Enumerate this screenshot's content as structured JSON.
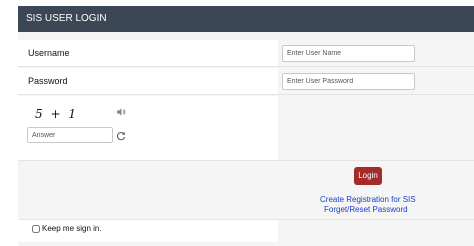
{
  "header": {
    "title": "SIS USER LOGIN"
  },
  "form": {
    "username_label": "Username",
    "username_placeholder": "Enter User Name",
    "password_label": "Password",
    "password_placeholder": "Enter User Password",
    "captcha_text": "5 + 1",
    "answer_placeholder": "Answer",
    "login_label": "Login",
    "create_registration_link": "Create Registration for SIS",
    "forget_reset_link": "Forget/Reset Password",
    "keep_signed_in_label": "Keep me sign in."
  },
  "colors": {
    "header_bg": "#3b4754",
    "login_button": "#a52a2a",
    "link": "#1a3fc4"
  }
}
